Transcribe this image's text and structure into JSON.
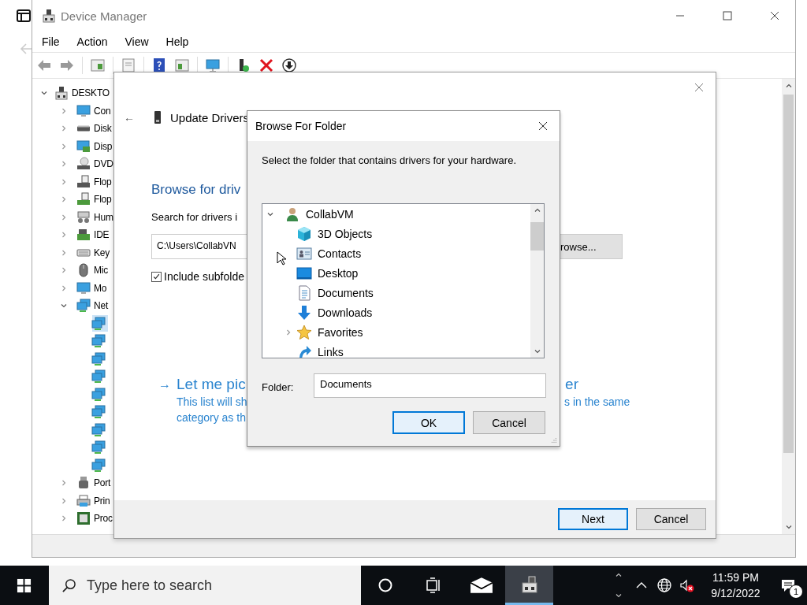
{
  "device_manager": {
    "title": "Device Manager",
    "menu": [
      "File",
      "Action",
      "View",
      "Help"
    ],
    "tree": {
      "label": "DESKTO",
      "expanded": true,
      "children": [
        {
          "label": "Con",
          "expanded": false
        },
        {
          "label": "Disk",
          "expanded": false
        },
        {
          "label": "Disp",
          "expanded": false
        },
        {
          "label": "DVD",
          "expanded": false
        },
        {
          "label": "Flop",
          "expanded": false
        },
        {
          "label": "Flop",
          "expanded": false
        },
        {
          "label": "Hum",
          "expanded": false
        },
        {
          "label": "IDE",
          "expanded": false
        },
        {
          "label": "Key",
          "expanded": false
        },
        {
          "label": "Mic",
          "expanded": false
        },
        {
          "label": "Mo",
          "expanded": false
        },
        {
          "label": "Net",
          "expanded": true,
          "children": [
            {
              "selected": true
            },
            {
              "selected": false
            },
            {
              "selected": false
            },
            {
              "selected": false
            },
            {
              "selected": false
            },
            {
              "selected": false
            },
            {
              "selected": false
            },
            {
              "selected": false
            },
            {
              "selected": false
            }
          ]
        },
        {
          "label": "Port",
          "expanded": false
        },
        {
          "label": "Prin",
          "expanded": false
        },
        {
          "label": "Proc",
          "expanded": false
        }
      ]
    }
  },
  "update_drivers": {
    "back": "←",
    "heading": "Update Drivers",
    "title": "Browse for driv",
    "search_label": "Search for drivers i",
    "path_value": "C:\\Users\\CollabVN",
    "browse_button": "rowse...",
    "include_subfolders": {
      "label": "Include subfolde",
      "checked": true
    },
    "pick_link": {
      "arrow": "→",
      "left": "Let me pic",
      "right": "er"
    },
    "pick_description": [
      {
        "left": "This list will sh",
        "right": "s in the same"
      },
      {
        "left": "category as th"
      }
    ],
    "next_button": "Next",
    "cancel_button": "Cancel"
  },
  "browse_for_folder": {
    "title": "Browse For Folder",
    "instruction": "Select the folder that contains drivers for your hardware.",
    "tree": {
      "label": "CollabVM",
      "expanded": true,
      "children": [
        {
          "label": "3D Objects",
          "expandable": false
        },
        {
          "label": "Contacts",
          "expandable": false
        },
        {
          "label": "Desktop",
          "expandable": false
        },
        {
          "label": "Documents",
          "expandable": false
        },
        {
          "label": "Downloads",
          "expandable": false
        },
        {
          "label": "Favorites",
          "expandable": true
        },
        {
          "label": "Links",
          "expandable": false
        }
      ]
    },
    "folder_label": "Folder:",
    "folder_value": "Documents",
    "ok_button": "OK",
    "cancel_button": "Cancel"
  },
  "taskbar": {
    "search_placeholder": "Type here to search",
    "apps": [
      {
        "selected": false
      },
      {
        "selected": true
      }
    ],
    "time": "11:59 PM",
    "date": "9/12/2022",
    "notification_count": "1"
  }
}
